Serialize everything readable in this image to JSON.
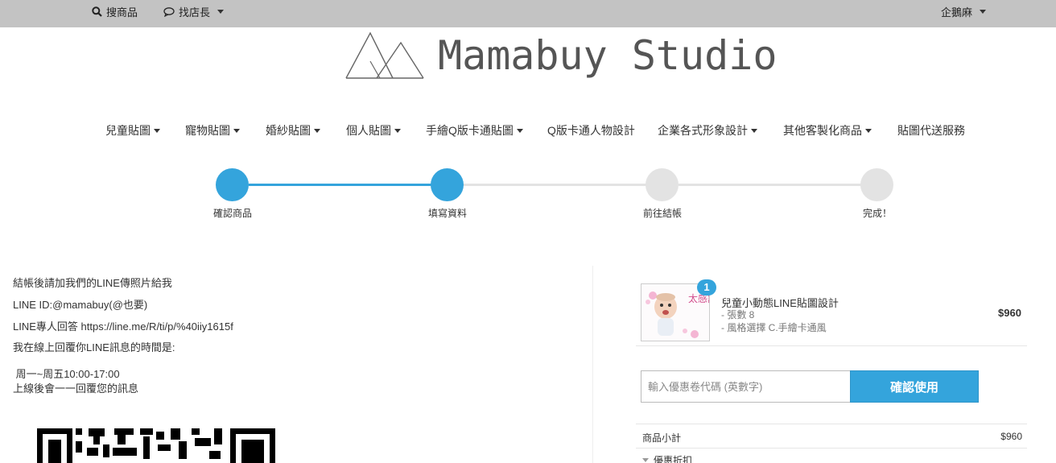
{
  "topbar": {
    "search_label": "搜商品",
    "contact_label": "找店長",
    "account_label": "企鵝麻"
  },
  "logo": {
    "text": "Mamabuy Studio"
  },
  "nav": {
    "items": [
      {
        "label": "兒童貼圖",
        "dropdown": true
      },
      {
        "label": "寵物貼圖",
        "dropdown": true
      },
      {
        "label": "婚紗貼圖",
        "dropdown": true
      },
      {
        "label": "個人貼圖",
        "dropdown": true
      },
      {
        "label": "手繪Q版卡通貼圖",
        "dropdown": true
      },
      {
        "label": "Q版卡通人物設計",
        "dropdown": false
      },
      {
        "label": "企業各式形象設計",
        "dropdown": true
      },
      {
        "label": "其他客製化商品",
        "dropdown": true
      },
      {
        "label": "貼圖代送服務",
        "dropdown": false
      }
    ]
  },
  "steps": {
    "items": [
      {
        "label": "確認商品",
        "active": true
      },
      {
        "label": "填寫資料",
        "active": true
      },
      {
        "label": "前往結帳",
        "active": false
      },
      {
        "label": "完成！",
        "active": false
      }
    ],
    "active_color": "#34a4dc",
    "inactive_color": "#e3e3e3"
  },
  "info": {
    "line1": "結帳後請加我們的LINE傳照片給我",
    "line2": "LINE ID:@mamabuy(@也要)",
    "line3": "LINE專人回答 https://line.me/R/ti/p/%40iiy1615f",
    "line4": "我在線上回覆你LINE訊息的時間是:",
    "line5": " 周一~周五10:00-17:00",
    "line6": "上線後會一一回覆您的訊息"
  },
  "cart": {
    "quantity_badge": "1",
    "product_title": "兒童小動態LINE貼圖設計",
    "option1": "- 張數 8",
    "option2": "- 風格選擇 C.手繪卡通風",
    "price": "$960",
    "thumb_text": "太感謝了"
  },
  "coupon": {
    "placeholder": "輸入優惠卷代碼 (英數字)",
    "button_label": "確認使用"
  },
  "summary": {
    "subtotal_label": "商品小計",
    "subtotal_value": "$960",
    "discount_label": "優惠折扣"
  }
}
